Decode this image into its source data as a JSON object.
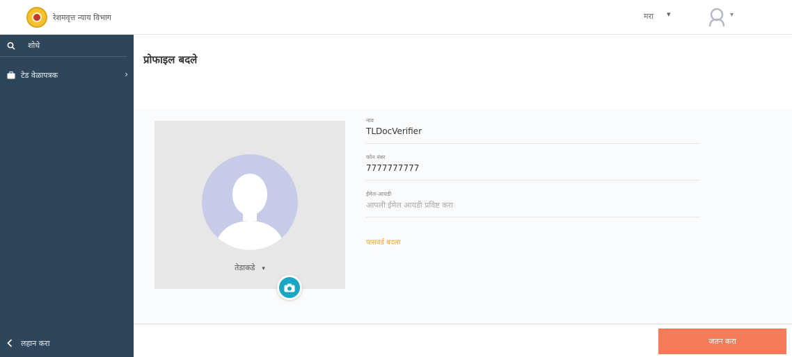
{
  "header": {
    "brand_name": "रेशमवृत्त न्याय विभाग",
    "language": "मरा",
    "language_caret": "▾",
    "user_caret": "▾"
  },
  "sidebar": {
    "search_label": "शोधे",
    "items": [
      {
        "label": "टेड वेळापत्रक",
        "icon": "briefcase-icon",
        "chevron": "›"
      }
    ],
    "footer_label": "लहान करा",
    "footer_icon": "chevron-left-icon"
  },
  "main": {
    "title": "प्रोफाइल बदले",
    "profile_card": {
      "name": "तेडाकडे",
      "caret": "▾"
    },
    "form": {
      "fields": [
        {
          "label": "नाव",
          "value": "TLDocVerifier"
        },
        {
          "label": "फोन नंबर",
          "value": "7777777777"
        },
        {
          "label": "ईमेल-आयडी",
          "placeholder": "आपली ईमेल आयडी प्रविष्ट करा"
        }
      ],
      "change_link": "पासवर्ड बदला"
    },
    "save_button": "जतन करा"
  },
  "colors": {
    "sidebar_bg": "#2f4559",
    "accent_orange": "#f47c5a",
    "link_orange": "#f5a623",
    "camera_teal": "#1aa6c4",
    "avatar_bg": "#c7cbe7"
  }
}
